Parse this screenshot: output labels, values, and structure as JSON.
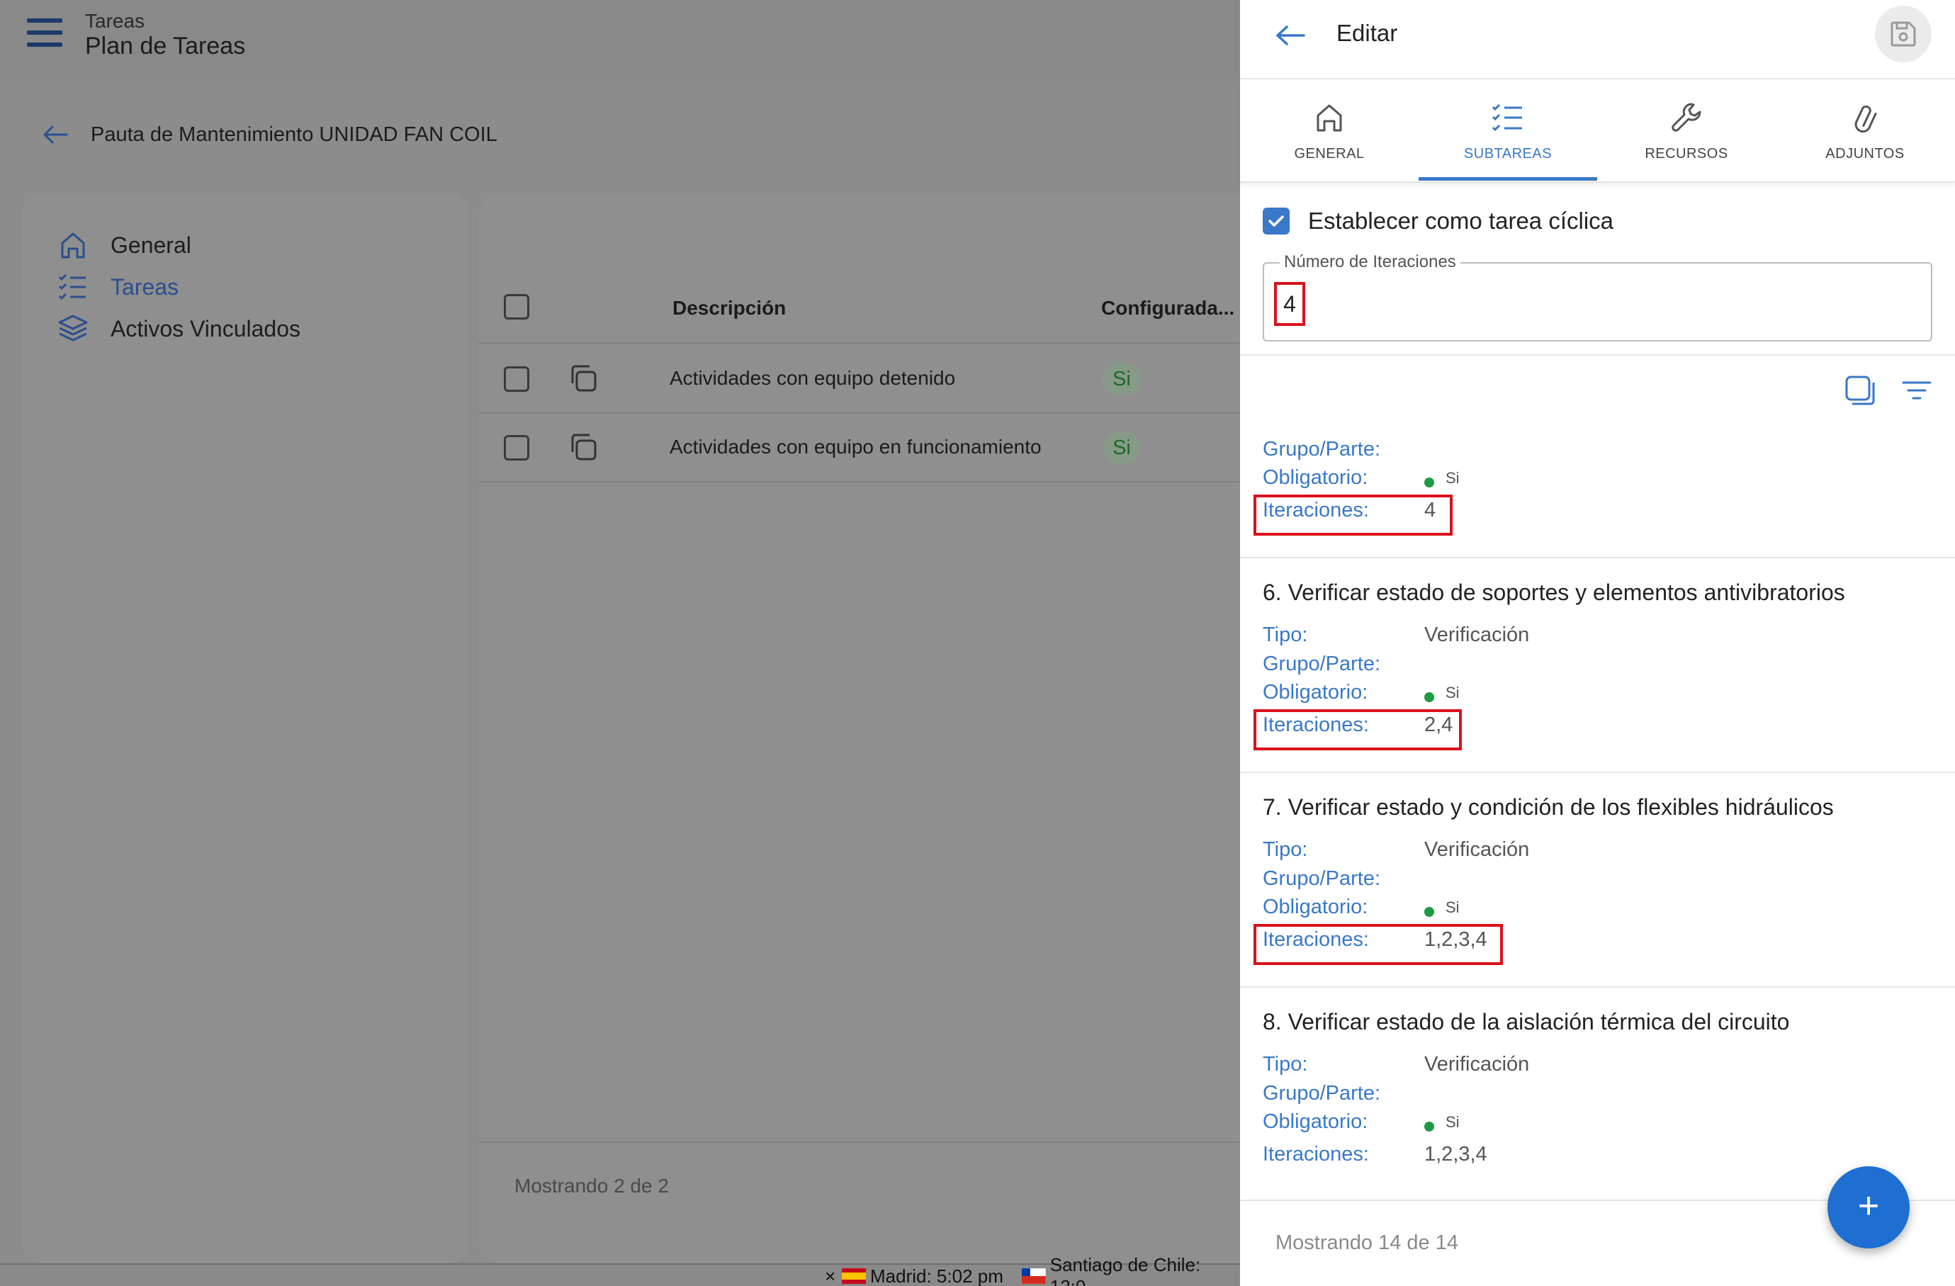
{
  "topbar": {
    "subtitle": "Tareas",
    "title": "Plan de Tareas"
  },
  "breadcrumb": {
    "text": "Pauta de Mantenimiento UNIDAD FAN COIL"
  },
  "sidebar": {
    "items": [
      {
        "label": "General",
        "icon": "home-icon"
      },
      {
        "label": "Tareas",
        "icon": "checklist-icon",
        "active": true
      },
      {
        "label": "Activos Vinculados",
        "icon": "layers-icon"
      }
    ]
  },
  "table": {
    "columns": [
      "Descripción",
      "Configurada..."
    ],
    "rows": [
      {
        "description": "Actividades con equipo detenido",
        "configured": "Si"
      },
      {
        "description": "Actividades con equipo en funcionamiento",
        "configured": "Si"
      }
    ],
    "footer": "Mostrando 2 de 2"
  },
  "statusbar": {
    "close": "×",
    "madrid": "Madrid: 5:02 pm",
    "santiago": "Santiago de Chile: 12:0"
  },
  "panel": {
    "title": "Editar",
    "tabs": [
      {
        "label": "GENERAL",
        "icon": "home-icon"
      },
      {
        "label": "SUBTAREAS",
        "icon": "checklist-icon",
        "active": true
      },
      {
        "label": "RECURSOS",
        "icon": "wrench-icon"
      },
      {
        "label": "ADJUNTOS",
        "icon": "paperclip-icon"
      }
    ],
    "cyclic_label": "Establecer como tarea cíclica",
    "cyclic_checked": true,
    "iterations_field": {
      "label": "Número de Iteraciones",
      "value": "4"
    },
    "field_labels": {
      "tipo": "Tipo:",
      "grupo": "Grupo/Parte:",
      "obligatorio": "Obligatorio:",
      "iteraciones": "Iteraciones:"
    },
    "partial_item": {
      "obligatorio": "Si",
      "iteraciones": "4"
    },
    "items": [
      {
        "title": "6. Verificar estado de soportes y elementos antivibratorios",
        "tipo": "Verificación",
        "obligatorio": "Si",
        "iteraciones": "2,4"
      },
      {
        "title": "7. Verificar estado y condición de los flexibles hidráulicos",
        "tipo": "Verificación",
        "obligatorio": "Si",
        "iteraciones": "1,2,3,4"
      },
      {
        "title": "8. Verificar estado de la aislación térmica del circuito",
        "tipo": "Verificación",
        "obligatorio": "Si",
        "iteraciones": "1,2,3,4"
      }
    ],
    "footer": "Mostrando 14 de 14",
    "fab_label": "+"
  },
  "colors": {
    "accent": "#3a78c9",
    "highlight": "#d9121b",
    "fab": "#1f6fd3",
    "ok": "#1e9a45"
  }
}
